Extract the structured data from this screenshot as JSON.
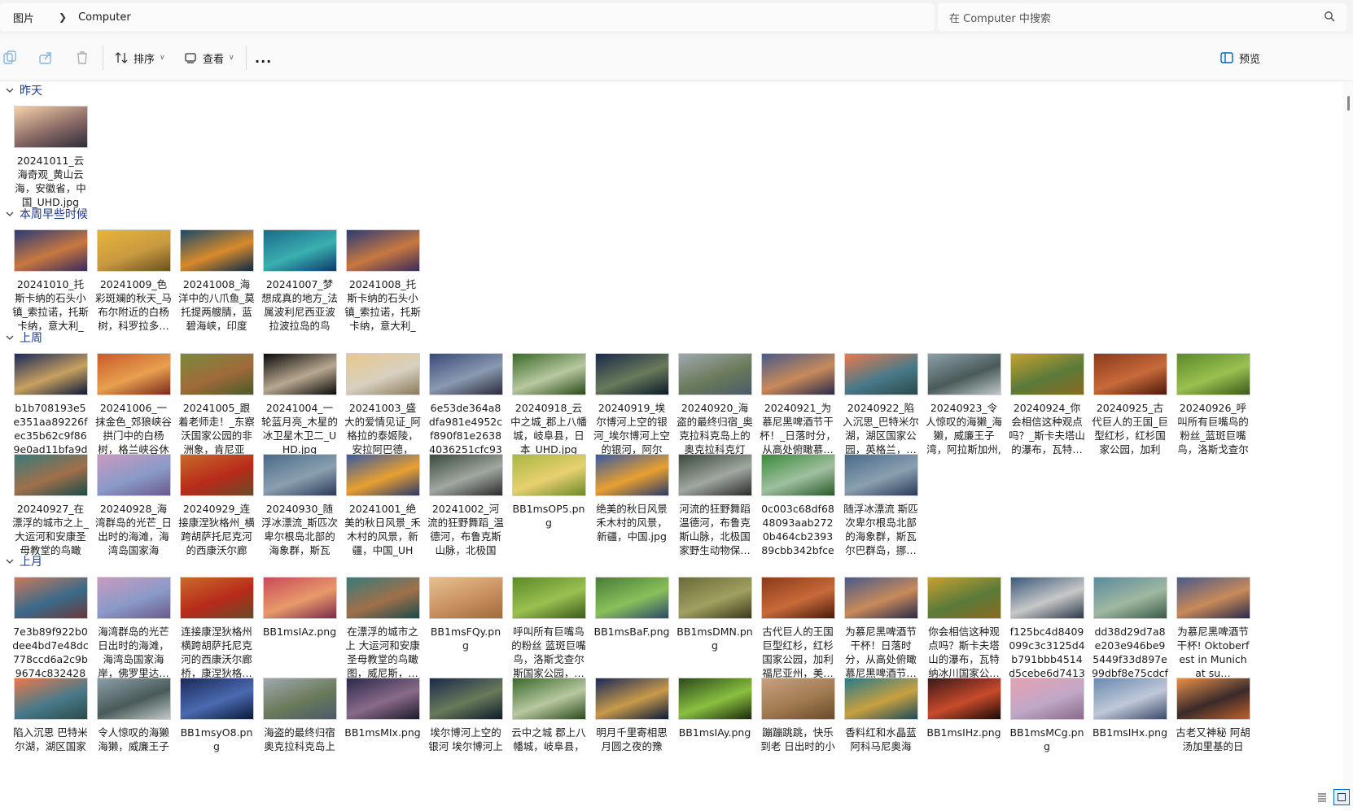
{
  "breadcrumb": {
    "root": "图片",
    "current": "Computer"
  },
  "search": {
    "placeholder": "在 Computer 中搜索"
  },
  "toolbar": {
    "sort_label": "排序",
    "view_label": "查看",
    "more_label": "...",
    "preview_label": "预览"
  },
  "groups": [
    {
      "name": "昨天",
      "items": [
        {
          "label": "20241011_云海奇观_黄山云海，安徽省，中国_UHD.jpg",
          "colors": [
            "#f6d2a8",
            "#8a6a66",
            "#2e2c3a"
          ]
        }
      ]
    },
    {
      "name": "本周早些时候",
      "items": [
        {
          "label": "20241010_托斯卡纳的石头小镇_索拉诺，托斯卡纳，意大利_U…",
          "colors": [
            "#2a3a78",
            "#c87840",
            "#3a2a5a"
          ]
        },
        {
          "label": "20241009_色彩斑斓的秋天_马布尔附近的白杨树，科罗拉多…",
          "colors": [
            "#e8b43a",
            "#c89a40",
            "#6a5020"
          ]
        },
        {
          "label": "20241008_海洋中的八爪鱼_莫托提两艘腈，蓝碧海峡，印度尼…",
          "colors": [
            "#1a4a6a",
            "#d88a2a",
            "#0a2a4a"
          ]
        },
        {
          "label": "20241007_梦想成真的地方_法属波利尼西亚波拉波拉岛的鸟瞰…",
          "colors": [
            "#1a6a8a",
            "#3ab0b0",
            "#0a3a6a"
          ]
        },
        {
          "label": "20241008_托斯卡纳的石头小镇_索拉诺，托斯卡纳，意大利_U…",
          "colors": [
            "#2a3a78",
            "#c87840",
            "#3a2a5a"
          ]
        }
      ]
    },
    {
      "name": "上周",
      "items": [
        {
          "label": "b1b708193e5e351aa89226fec35b62c9f869e0ad11bfa9db6…",
          "colors": [
            "#1a2a5a",
            "#c8a060",
            "#0a1a3a"
          ]
        },
        {
          "label": "20241006_一抹金色_郊狼峡谷拱门中的白杨树，格兰峡谷休闲…",
          "colors": [
            "#c85a2a",
            "#e8a050",
            "#7a2a1a"
          ]
        },
        {
          "label": "20241005_跟着老师走！_东察沃国家公园的非洲象，肯尼亚_U…",
          "colors": [
            "#7a8a3a",
            "#a06a3a",
            "#4a5a2a"
          ]
        },
        {
          "label": "20241004_一轮蓝月亮_木星的冰卫星木卫二_UHD.jpg",
          "colors": [
            "#0a0a0a",
            "#b8a890",
            "#0a0a0a"
          ]
        },
        {
          "label": "20241003_盛大的爱情见证_阿格拉的泰姬陵，安拉阿巴德，印…",
          "colors": [
            "#e8c88a",
            "#d8d0c0",
            "#8a7a5a"
          ]
        },
        {
          "label": "6e53de364a8dfa981e4952cf890f81e26384036251cfc930124…",
          "colors": [
            "#3a4a7a",
            "#8a9ab0",
            "#2a2a3a"
          ]
        },
        {
          "label": "20240918_云中之城_郡上八幡城，岐阜县，日本_UHD.jpg",
          "colors": [
            "#3a6a2a",
            "#b8c8a0",
            "#2a4a1a"
          ]
        },
        {
          "label": "20240919_埃尔博河上空的银河_埃尔博河上空的银河，阿尔伯…",
          "colors": [
            "#1a2a4a",
            "#6a7a5a",
            "#0a1a2a"
          ]
        },
        {
          "label": "20240920_海盗的最终归宿_奥克拉科克岛上的奥克拉科克灯塔…",
          "colors": [
            "#a0a8b0",
            "#6a7a5a",
            "#4a5a6a"
          ]
        },
        {
          "label": "20240921_为慕尼黑啤酒节干杯！_日落时分，从高处俯瞰慕…",
          "colors": [
            "#4a5a8a",
            "#c88a5a",
            "#2a2a4a"
          ]
        },
        {
          "label": "20240922_陷入沉思_巴特米尔湖，湖区国家公园，英格兰，…",
          "colors": [
            "#e87a4a",
            "#4a7a8a",
            "#2a4a4a"
          ]
        },
        {
          "label": "20240923_令人惊叹的海獭_海獭，威廉王子湾，阿拉斯加州,美…",
          "colors": [
            "#8aa0a8",
            "#4a5a5a",
            "#c0c8c8"
          ]
        },
        {
          "label": "20240924_你会相信这种观点吗？_斯卡夫塔山的瀑布，瓦特…",
          "colors": [
            "#c8a030",
            "#5a7a3a",
            "#8a6a20"
          ]
        },
        {
          "label": "20240925_古代巨人的王国_巨型红杉，红杉国家公园，加利福…",
          "colors": [
            "#8a3a1a",
            "#c86a3a",
            "#4a1a0a"
          ]
        },
        {
          "label": "20240926_呼叫所有巨嘴鸟的粉丝_蓝斑巨嘴鸟，洛斯戈查尔斯…",
          "colors": [
            "#5a8a2a",
            "#9ac050",
            "#3a5a1a"
          ]
        },
        {
          "label": "20240927_在漂浮的城市之上_大运河和安康圣母教堂的鸟瞰图…",
          "colors": [
            "#3a7a7a",
            "#a0704a",
            "#1a4a4a"
          ]
        },
        {
          "label": "20240928_海湾群岛的光芒_日出时的海滩，海湾岛国家海岸，…",
          "colors": [
            "#c89ac0",
            "#8a9ac8",
            "#6a5a8a"
          ]
        },
        {
          "label": "20240929_连接康涅狄格州_横跨胡萨托尼克河的西康沃尔廊桥…",
          "colors": [
            "#c86a2a",
            "#b82a1a",
            "#6a4a2a"
          ]
        },
        {
          "label": "20240930_随浮冰漂流_斯匹次卑尔根岛北部的海象群，斯瓦尔…",
          "colors": [
            "#4a6a8a",
            "#8aa0b0",
            "#2a3a5a"
          ]
        },
        {
          "label": "20241001_绝美的秋日风景_禾木村的风景，新疆，中国_UHD…",
          "colors": [
            "#3a5aa0",
            "#e8a030",
            "#2a3a6a"
          ]
        },
        {
          "label": "20241002_河流的狂野舞蹈_温德河，布鲁克斯山脉，北极国家…",
          "colors": [
            "#3a4a3a",
            "#a0a8a0",
            "#2a2a2a"
          ]
        },
        {
          "label": "BB1msOP5.png",
          "colors": [
            "#a8b840",
            "#e8d070",
            "#6a8a2a"
          ]
        },
        {
          "label": "绝美的秋日风景 禾木村的风景，新疆，中国.jpg",
          "colors": [
            "#3a5aa0",
            "#e8a030",
            "#2a3a6a"
          ]
        },
        {
          "label": "河流的狂野舞蹈 温德河，布鲁克斯山脉，北极国家野生动物保…",
          "colors": [
            "#3a4a3a",
            "#a0a8a0",
            "#2a2a2a"
          ]
        },
        {
          "label": "0c003c68df6848093aab2720b464cb239389cbb342bfce1d6…",
          "colors": [
            "#3a8a3a",
            "#a0c0a0",
            "#2a5a2a"
          ]
        },
        {
          "label": "随浮冰漂流 斯匹次卑尔根岛北部的海象群，斯瓦尔巴群岛，挪…",
          "colors": [
            "#4a6a8a",
            "#8aa0b0",
            "#2a3a5a"
          ]
        }
      ]
    },
    {
      "name": "上月",
      "items": [
        {
          "label": "7e3b89f922b0dee4bd7e48dc778ccd6a2c9b9674c832428efb…",
          "colors": [
            "#c87a5a",
            "#3a6a8a",
            "#6a3a3a"
          ]
        },
        {
          "label": "海湾群岛的光芒 日出时的海滩，海湾岛国家海岸，佛罗里达…",
          "colors": [
            "#c89ac0",
            "#8a9ac8",
            "#6a5a8a"
          ]
        },
        {
          "label": "连接康涅狄格州 横跨胡萨托尼克河的西康沃尔廊桥，康涅狄格…",
          "colors": [
            "#c86a2a",
            "#b82a1a",
            "#6a4a2a"
          ]
        },
        {
          "label": "BB1msIAz.png",
          "colors": [
            "#c84a5a",
            "#e89a6a",
            "#7a2a4a"
          ]
        },
        {
          "label": "在漂浮的城市之上 大运河和安康圣母教堂的鸟瞰图，威尼斯，…",
          "colors": [
            "#3a7a7a",
            "#a0704a",
            "#1a4a4a"
          ]
        },
        {
          "label": "BB1msFQy.png",
          "colors": [
            "#e8c090",
            "#c89060",
            "#a06a3a"
          ]
        },
        {
          "label": "呼叫所有巨嘴鸟的粉丝 蓝斑巨嘴鸟，洛斯戈查尔斯国家公园，…",
          "colors": [
            "#5a8a2a",
            "#9ac050",
            "#3a5a1a"
          ]
        },
        {
          "label": "BB1msBaF.png",
          "colors": [
            "#4a7a3a",
            "#8ac05a",
            "#2a4a6a"
          ]
        },
        {
          "label": "BB1msDMN.png",
          "colors": [
            "#6a6a3a",
            "#a0a060",
            "#3a3a1a"
          ]
        },
        {
          "label": "古代巨人的王国 巨型红杉，红杉国家公园，加利福尼亚州，美…",
          "colors": [
            "#8a3a1a",
            "#c86a3a",
            "#4a1a0a"
          ]
        },
        {
          "label": "为慕尼黑啤酒节干杯！日落时分，从高处俯瞰慕尼黑啤酒节…",
          "colors": [
            "#4a5a8a",
            "#c88a5a",
            "#2a2a4a"
          ]
        },
        {
          "label": "你会相信这种观点吗？斯卡夫塔山的瀑布，瓦特纳冰川国家公…",
          "colors": [
            "#c8a030",
            "#5a7a3a",
            "#8a6a20"
          ]
        },
        {
          "label": "f125bc4d8409099c3c3125d4b791bbb4514d5cebe6d7413c9…",
          "colors": [
            "#3a5a7a",
            "#c8c8c8",
            "#2a3a4a"
          ]
        },
        {
          "label": "dd38d29d7a8e203e946be95449f33d897e99dbf8e75cdcfcd0…",
          "colors": [
            "#5a8aa0",
            "#a0b8a0",
            "#3a5a4a"
          ]
        },
        {
          "label": "为慕尼黑啤酒节干杯! Oktoberfest in Munich at su…",
          "colors": [
            "#4a5a8a",
            "#c88a5a",
            "#2a2a4a"
          ]
        },
        {
          "label": "陷入沉思 巴特米尔湖，湖区国家",
          "colors": [
            "#e87a4a",
            "#4a7a8a",
            "#2a4a4a"
          ]
        },
        {
          "label": "令人惊叹的海獭 海獭，威廉王子",
          "colors": [
            "#8aa0a8",
            "#4a5a5a",
            "#c0c8c8"
          ]
        },
        {
          "label": "BB1msyO8.png",
          "colors": [
            "#1a2a5a",
            "#4a6ab0",
            "#0a1a3a"
          ]
        },
        {
          "label": "海盗的最终归宿 奥克拉科克岛上",
          "colors": [
            "#a0a8b0",
            "#6a7a5a",
            "#4a5a6a"
          ]
        },
        {
          "label": "BB1msMIx.png",
          "colors": [
            "#2a2a4a",
            "#8a6a8a",
            "#1a1a2a"
          ]
        },
        {
          "label": "埃尔博河上空的银河 埃尔博河上",
          "colors": [
            "#1a2a4a",
            "#6a7a5a",
            "#0a1a2a"
          ]
        },
        {
          "label": "云中之城 郡上八幡城，岐阜县，",
          "colors": [
            "#3a6a2a",
            "#b8c8a0",
            "#2a4a1a"
          ]
        },
        {
          "label": "明月千里寄相思 月圆之夜的豫",
          "colors": [
            "#1a2a5a",
            "#c89a4a",
            "#0a1a3a"
          ]
        },
        {
          "label": "BB1msIAy.png",
          "colors": [
            "#2a4a1a",
            "#8ac040",
            "#1a2a0a"
          ]
        },
        {
          "label": "蹦蹦跳跳，快乐到老 日出时的小",
          "colors": [
            "#c8a080",
            "#a07a50",
            "#6a4a2a"
          ]
        },
        {
          "label": "香料红和水晶蓝 阿科马尼奥海",
          "colors": [
            "#2a7a8a",
            "#c8a040",
            "#1a4a5a"
          ]
        },
        {
          "label": "BB1msIHz.png",
          "colors": [
            "#3a1a1a",
            "#c84a2a",
            "#1a0a0a"
          ]
        },
        {
          "label": "BB1msMCg.png",
          "colors": [
            "#e8a0b0",
            "#c0a8c8",
            "#8a6a8a"
          ]
        },
        {
          "label": "BB1msIHx.png",
          "colors": [
            "#6a8ab0",
            "#c0c8d8",
            "#3a4a6a"
          ]
        },
        {
          "label": "古老又神秘 阿胡汤加里基的日",
          "colors": [
            "#e8904a",
            "#3a2a2a",
            "#c0602a"
          ]
        }
      ]
    }
  ]
}
